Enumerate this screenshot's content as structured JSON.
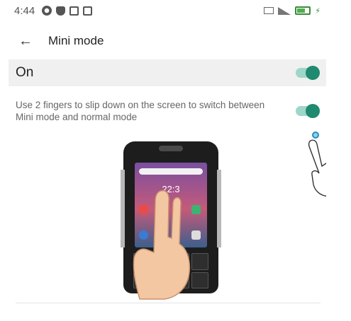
{
  "status_bar": {
    "time": "4:44",
    "left_icons": [
      "gear-icon",
      "shield-icon",
      "square-icon",
      "square-icon"
    ],
    "right_icons": [
      "hd-icon",
      "signal-icon",
      "battery-icon",
      "charging-icon"
    ]
  },
  "toolbar": {
    "back_icon": "arrow-left-icon",
    "back_glyph": "←",
    "title": "Mini mode"
  },
  "main_toggle": {
    "label": "On",
    "state": "on"
  },
  "gesture_toggle": {
    "description": "Use 2 fingers to slip down on the screen to switch between Mini mode and normal mode",
    "state": "on"
  },
  "illustration": {
    "clock_text": "22:3",
    "phone_icon": "phone-icon",
    "hand_icon": "hand-icon",
    "pointer_hand_icon": "pointing-hand-icon"
  },
  "colors": {
    "switch_on": "#1f8a6f",
    "switch_track_on": "#9ed6c9",
    "header_row_bg": "#f0f0f0",
    "battery": "#4fae4f"
  }
}
